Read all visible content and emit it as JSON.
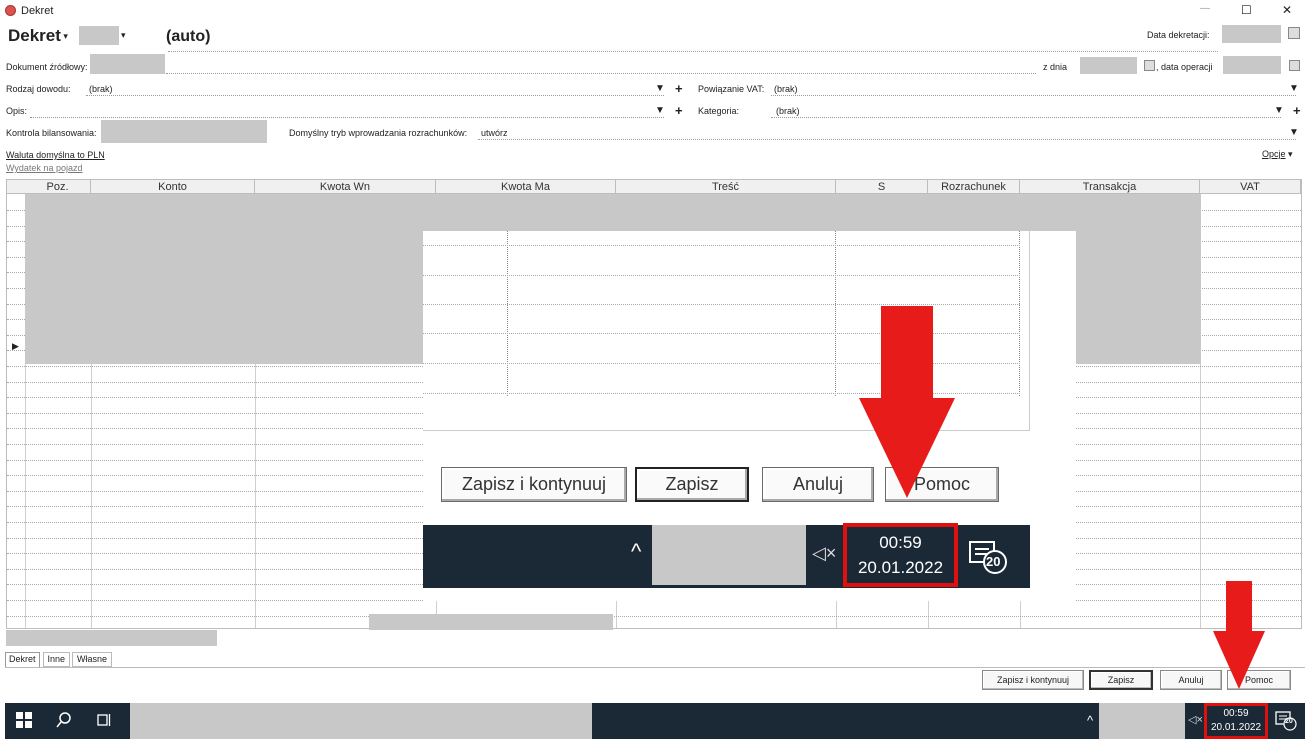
{
  "window": {
    "title": "Dekret",
    "controls": {
      "minimize": "—",
      "maximize": "☐",
      "close": "✕"
    }
  },
  "header": {
    "menu_title": "Dekret",
    "auto_label": "(auto)",
    "data_dekretacji_label": "Data dekretacji:"
  },
  "form": {
    "dokument_label": "Dokument źródłowy:",
    "z_dnia_label": "z dnia",
    "data_operacji_label": ", data operacji",
    "rodzaj_label": "Rodzaj dowodu:",
    "rodzaj_value": "(brak)",
    "powiazanie_label": "Powiązanie VAT:",
    "powiazanie_value": "(brak)",
    "opis_label": "Opis:",
    "kategoria_label": "Kategoria:",
    "kategoria_value": "(brak)",
    "kontrola_label": "Kontrola bilansowania:",
    "domyslny_label": "Domyślny tryb wprowadzania rozrachunków:",
    "domyslny_value": "utwórz",
    "waluta_link": "Waluta domyślna to PLN",
    "wydatek_link": "Wydatek na pojazd",
    "opcje_label": "Opcje"
  },
  "grid": {
    "columns": [
      "Poz.",
      "Konto",
      "Kwota Wn",
      "Kwota Ma",
      "Treść",
      "S",
      "Rozrachunek",
      "Transakcja",
      "VAT"
    ]
  },
  "tabs": [
    "Dekret",
    "Inne",
    "Własne"
  ],
  "buttons": {
    "save_continue": "Zapisz i kontynuuj",
    "save": "Zapisz",
    "cancel": "Anuluj",
    "help": "Pomoc"
  },
  "taskbar": {
    "time": "00:59",
    "date": "20.01.2022",
    "notification_count": "20",
    "mute_symbol": "🔇",
    "chevron_symbol": "^"
  },
  "zoom": {
    "time": "00:59",
    "date": "20.01.2022",
    "notification_count": "20"
  },
  "colors": {
    "taskbar_bg": "#1b2836",
    "highlight_red": "#e01010",
    "arrow_red": "#e81b1b",
    "gray_redaction": "#c8c8c8"
  }
}
